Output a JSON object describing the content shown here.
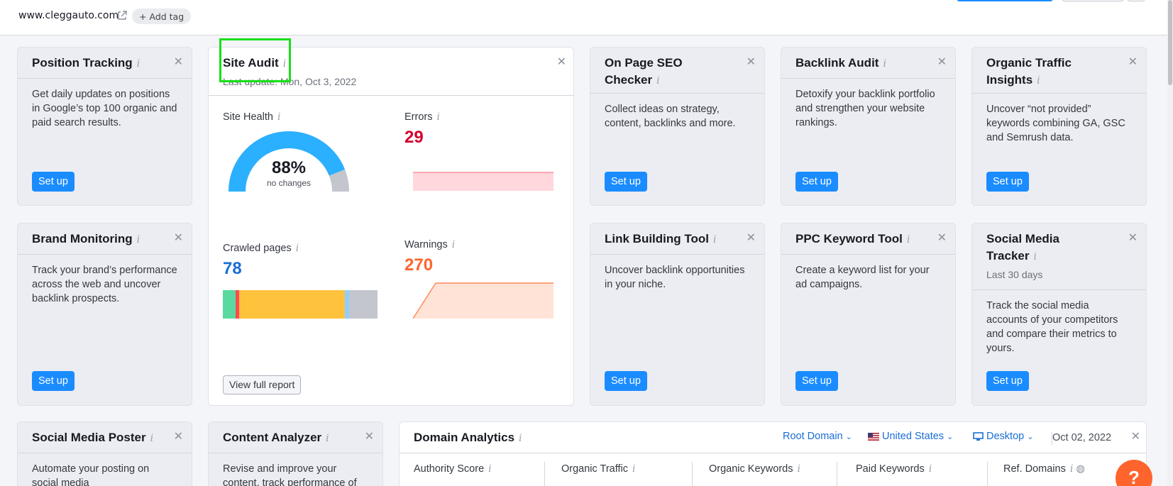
{
  "header": {
    "domain": "www.cleggauto.com",
    "add_tag": "Add tag"
  },
  "cards": {
    "position_tracking": {
      "title": "Position Tracking",
      "desc": "Get daily updates on positions in Google’s top 100 organic and paid search results.",
      "button": "Set up"
    },
    "site_audit": {
      "title": "Site Audit",
      "last_update": "Last update: Mon, Oct 3, 2022",
      "site_health_label": "Site Health",
      "site_health_value": "88%",
      "site_health_fraction": 0.88,
      "site_health_note": "no changes",
      "errors_label": "Errors",
      "errors_value": "29",
      "crawled_label": "Crawled pages",
      "crawled_value": "78",
      "warnings_label": "Warnings",
      "warnings_value": "270",
      "view_button": "View full report"
    },
    "on_page_seo": {
      "title_line1": "On Page SEO",
      "title_line2": "Checker",
      "desc": "Collect ideas on strategy, content, backlinks and more.",
      "button": "Set up"
    },
    "backlink_audit": {
      "title": "Backlink Audit",
      "desc": "Detoxify your backlink portfolio and strengthen your website rankings.",
      "button": "Set up"
    },
    "organic_traffic": {
      "title_line1": "Organic Traffic",
      "title_line2": "Insights",
      "desc": "Uncover “not provided” keywords combining GA, GSC and Semrush data.",
      "button": "Set up"
    },
    "brand_monitoring": {
      "title": "Brand Monitoring",
      "desc": "Track your brand’s performance across the web and uncover backlink prospects.",
      "button": "Set up"
    },
    "link_building": {
      "title": "Link Building Tool",
      "desc": "Uncover backlink opportunities in your niche.",
      "button": "Set up"
    },
    "ppc_keyword": {
      "title": "PPC Keyword Tool",
      "desc": "Create a keyword list for your ad campaigns.",
      "button": "Set up"
    },
    "social_tracker": {
      "title_line1": "Social Media",
      "title_line2": "Tracker",
      "subtitle": "Last 30 days",
      "desc": "Track the social media accounts of your competitors and compare their metrics to yours.",
      "button": "Set up"
    },
    "social_poster": {
      "title": "Social Media Poster",
      "desc": "Automate your posting on social media"
    },
    "content_analyzer": {
      "title": "Content Analyzer",
      "desc": "Revise and improve your content, track performance of"
    },
    "domain_analytics": {
      "title": "Domain Analytics",
      "root_domain": "Root Domain",
      "country": "United States",
      "device": "Desktop",
      "date": "Oct 02, 2022",
      "columns": [
        "Authority Score",
        "Organic Traffic",
        "Organic Keywords",
        "Paid Keywords",
        "Ref. Domains"
      ]
    }
  },
  "colors": {
    "primary_blue": "#1a8cff",
    "error_red": "#d1002f",
    "warning_orange": "#ff642d",
    "health_blue": "#2bb0ff",
    "highlight_green": "#18e018"
  },
  "help_button": "?"
}
